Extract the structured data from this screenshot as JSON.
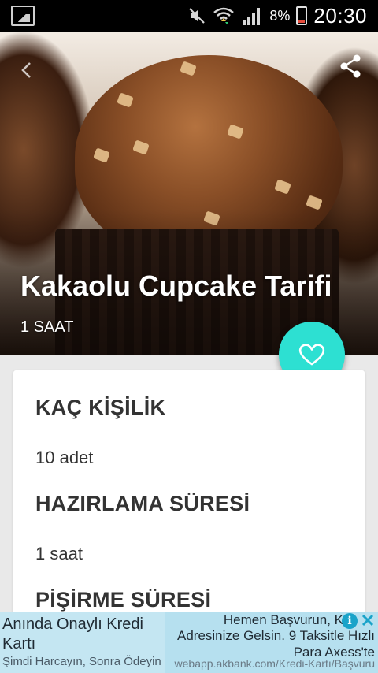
{
  "status_bar": {
    "battery": "8%",
    "time": "20:30"
  },
  "recipe": {
    "title": "Kakaolu Cupcake Tarifi",
    "duration": "1 SAAT"
  },
  "details": {
    "servings_label": "KAÇ KİŞİLİK",
    "servings_value": "10 adet",
    "prep_label": "HAZIRLAMA SÜRESİ",
    "prep_value": "1 saat",
    "cook_label": "PİŞİRME SÜRESİ"
  },
  "ad": {
    "left_headline": "Anında Onaylı Kredi Kartı",
    "left_subline": "Şimdi Harcayın, Sonra Ödeyin",
    "right_line1": "Hemen Başvurun, K",
    "right_line2": "Adresinize Gelsin. 9 Taksitle Hızlı Para Axess'te",
    "right_url": "webapp.akbank.com/Kredi-Kartı/Başvuru",
    "info_glyph": "i"
  },
  "colors": {
    "fab": "#2de0d2",
    "status_bar": "#000000",
    "ad_background": "#b6e0ef"
  },
  "icons": [
    "gallery-icon",
    "mute-icon",
    "wifi-icon",
    "signal-icon",
    "battery-icon",
    "back-arrow-icon",
    "share-icon",
    "heart-icon",
    "info-icon",
    "close-icon"
  ]
}
